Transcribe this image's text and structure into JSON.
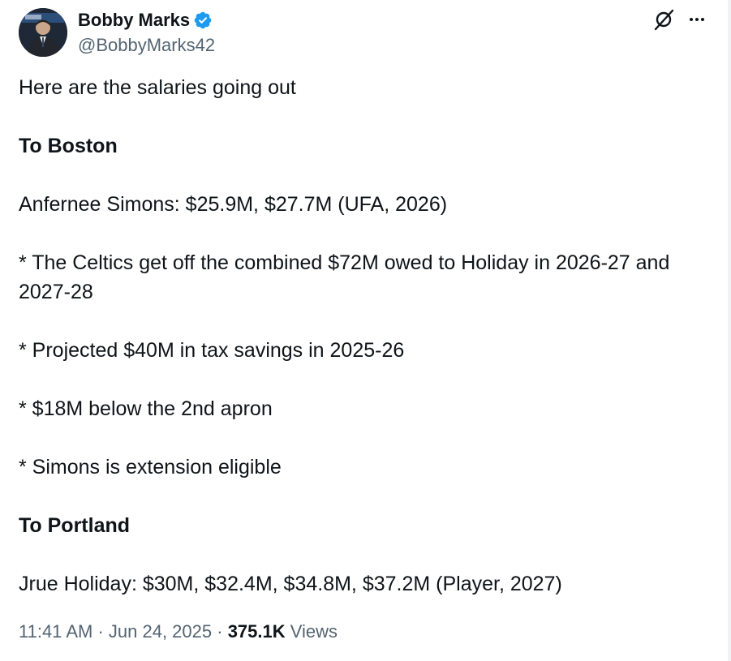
{
  "author": {
    "name": "Bobby Marks",
    "handle": "@BobbyMarks42",
    "verified_color": "#1d9bf0"
  },
  "header_icons": [
    "grok-icon",
    "more-icon"
  ],
  "tweet": {
    "intro": "Here are the salaries going out",
    "to_boston_heading": "To Boston",
    "boston_player": "Anfernee Simons: $25.9M, $27.7M (UFA, 2026)",
    "bullet_1": "* The Celtics get off the combined $72M owed to Holiday in 2026-27 and 2027-28",
    "bullet_2": "* Projected $40M in tax savings in 2025-26",
    "bullet_3": "* $18M below the 2nd apron",
    "bullet_4": "* Simons is extension eligible",
    "to_portland_heading": "To Portland",
    "portland_player": "Jrue Holiday: $30M, $32.4M, $34.8M, $37.2M (Player, 2027)"
  },
  "meta": {
    "time": "11:41 AM",
    "separator": " · ",
    "date": "Jun 24, 2025",
    "views_count": "375.1K",
    "views_label": "Views"
  }
}
